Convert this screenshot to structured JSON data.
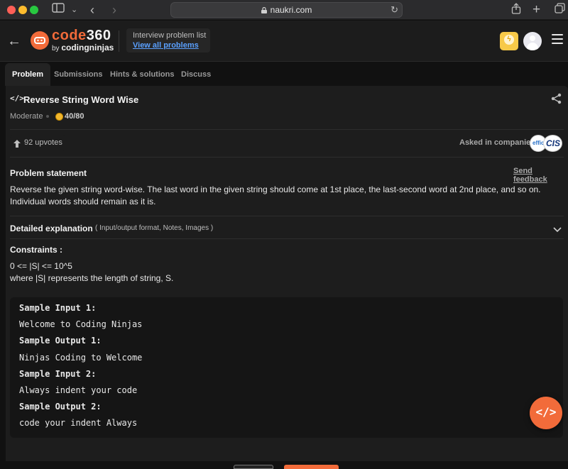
{
  "browser": {
    "address": "naukri.com",
    "icons": [
      "sidebar-icon",
      "chevron-down-icon",
      "back-icon",
      "forward-icon",
      "lock-icon",
      "reload-icon",
      "share-icon",
      "plus-icon",
      "tabs-icon"
    ]
  },
  "header": {
    "logo_main": "code",
    "logo_num": "360",
    "logo_by": "by",
    "logo_sub": "codingninjas",
    "list_title": "Interview problem list",
    "list_link": "View all problems"
  },
  "tabs": [
    "Problem",
    "Submissions",
    "Hints & solutions",
    "Discuss"
  ],
  "problem": {
    "title_icon": "</>",
    "title": "Reverse String Word Wise",
    "difficulty": "Moderate",
    "score": "40/80",
    "upvotes": "92 upvotes",
    "asked_label": "Asked in companies",
    "company_a": "effice",
    "company_b": "CIS"
  },
  "statement": {
    "heading": "Problem statement",
    "feedback": "Send feedback",
    "text_line1": "Reverse the given string word-wise. The last word in the given string should come at 1st place, the last-second word at 2nd place, and so on.",
    "text_line2": "Individual words should remain as it is."
  },
  "detail": {
    "heading": "Detailed explanation",
    "sub": "( Input/output format, Notes, Images )"
  },
  "constraints": {
    "heading": "Constraints :",
    "line1": "0 <= |S| <= 10^5",
    "line2": "where |S| represents the length of string, S."
  },
  "samples": [
    {
      "label": "Sample Input 1:",
      "value": "Welcome to Coding Ninjas"
    },
    {
      "label": "Sample Output 1:",
      "value": "Ninjas Coding to Welcome"
    },
    {
      "label": "Sample Input 2:",
      "value": "Always indent your code"
    },
    {
      "label": "Sample Output 2:",
      "value": "code your indent Always"
    }
  ],
  "fab": "</>",
  "colors": {
    "accent": "#f26b3a",
    "link": "#5aa0ff",
    "background": "#111111",
    "panel": "#1d1d1d"
  }
}
